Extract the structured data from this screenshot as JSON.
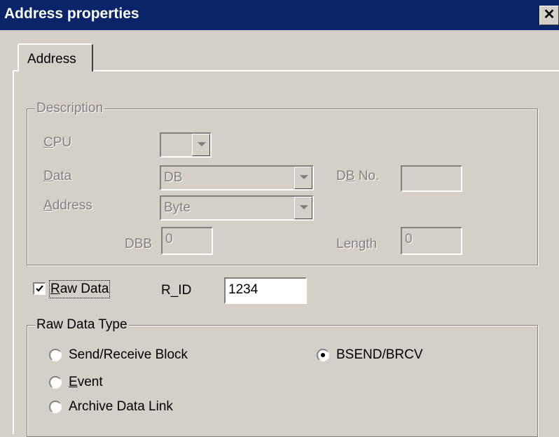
{
  "window": {
    "title": "Address properties",
    "close_glyph": "✕"
  },
  "tabs": [
    {
      "label": "Address"
    }
  ],
  "description": {
    "legend": "Description",
    "cpu": {
      "label_first": "C",
      "label_rest": "PU",
      "value": ""
    },
    "data": {
      "label_first": "D",
      "label_rest": "ata",
      "value": "DB"
    },
    "db_no": {
      "label_pre": "D",
      "label_u": "B",
      "label_post": " No.",
      "value": ""
    },
    "address": {
      "label_first": "A",
      "label_rest": "ddress",
      "value": "Byte"
    },
    "dbb": {
      "label": "DBB",
      "value": "0"
    },
    "length": {
      "label": "Length",
      "value": "0"
    }
  },
  "raw_data": {
    "checkbox_label_first": "R",
    "checkbox_label_rest": "aw Data",
    "checked": true,
    "r_id_label": "R_ID",
    "r_id_value": "1234"
  },
  "raw_data_type": {
    "legend": "Raw Data Type",
    "options": [
      {
        "label": "Send/Receive Block",
        "selected": false
      },
      {
        "label_first": "E",
        "label_rest": "vent",
        "selected": false
      },
      {
        "label": "Archive Data Link",
        "selected": false
      },
      {
        "label": "BSEND/BRCV",
        "selected": true
      }
    ]
  },
  "icons": {
    "combo_arrow": "chevron-down-icon",
    "checkbox": "checkmark-icon",
    "close": "close-icon"
  }
}
